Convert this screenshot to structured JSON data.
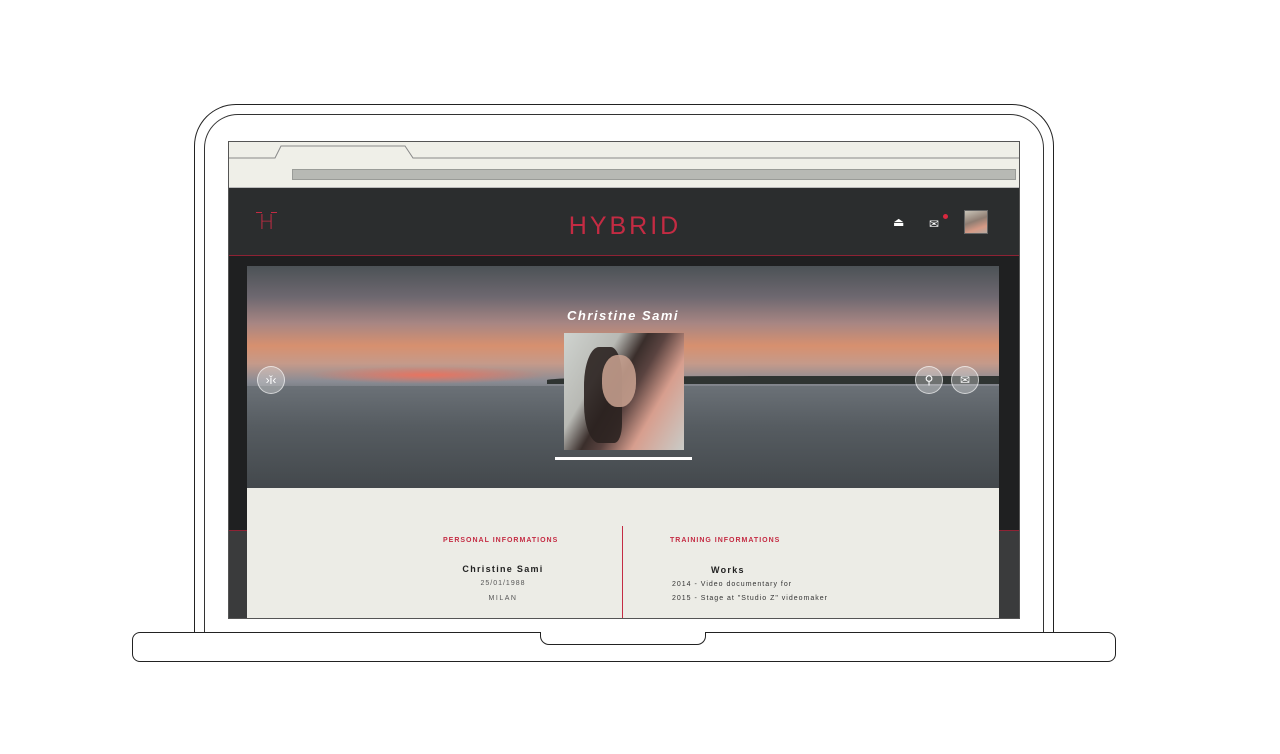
{
  "header": {
    "logo_letter": "H",
    "brand": "HYBRID",
    "icons": {
      "up": "eject-up-icon",
      "mail": "mail-icon",
      "avatar": "user-avatar"
    },
    "accent_color": "#c42b43"
  },
  "hero": {
    "name": "Christine Sami",
    "icons": {
      "left": "focus-person-icon",
      "location": "location-pin-icon",
      "mail": "mail-icon"
    }
  },
  "personal": {
    "title": "PERSONAL INFORMATIONS",
    "name": "Christine Sami",
    "birthdate": "25/01/1988",
    "city": "MILAN"
  },
  "training": {
    "title": "TRAINING INFORMATIONS",
    "heading": "Works",
    "items": [
      "2014 - Video documentary for",
      "2015 - Stage at \"Studio Z\" videomaker"
    ]
  }
}
